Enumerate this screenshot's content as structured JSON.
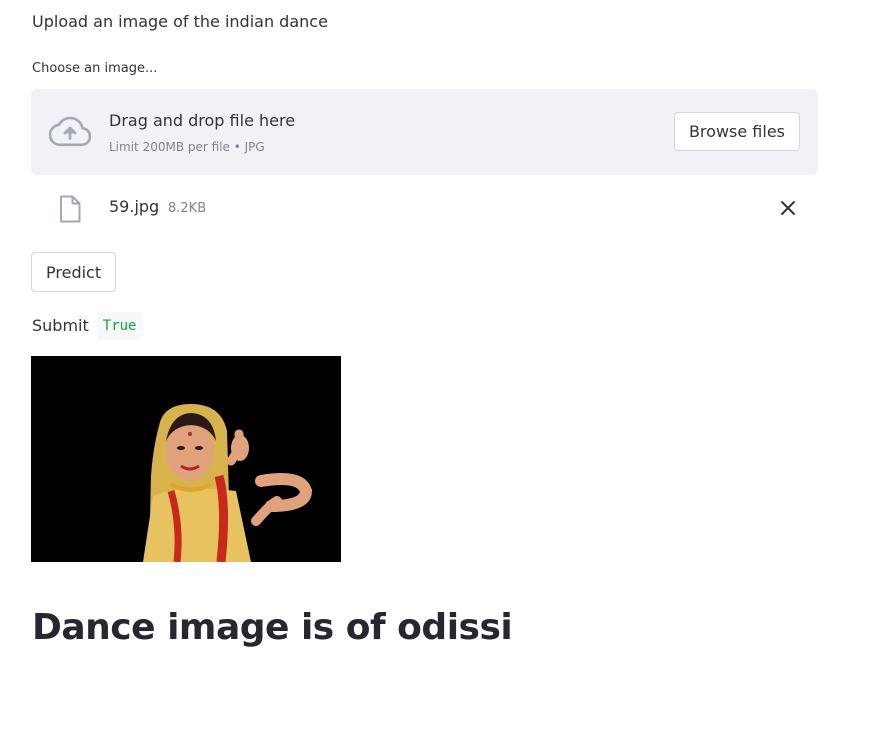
{
  "intro": {
    "text": "Upload an image of the indian dance"
  },
  "uploader": {
    "label": "Choose an image...",
    "drop_title": "Drag and drop file here",
    "drop_limit": "Limit 200MB per file • JPG",
    "browse_label": "Browse files",
    "icon": "cloud-upload-icon"
  },
  "file": {
    "name": "59.jpg",
    "size": "8.2KB",
    "icon": "file-icon",
    "remove_icon": "close-icon"
  },
  "predict": {
    "label": "Predict"
  },
  "submit": {
    "label": "Submit",
    "value": "True"
  },
  "result": {
    "heading": "Dance image is of odissi"
  },
  "colors": {
    "dropzone_bg": "#f0f2f6",
    "text": "#31333f",
    "muted": "#808495",
    "code_value": "#09ab3b"
  }
}
